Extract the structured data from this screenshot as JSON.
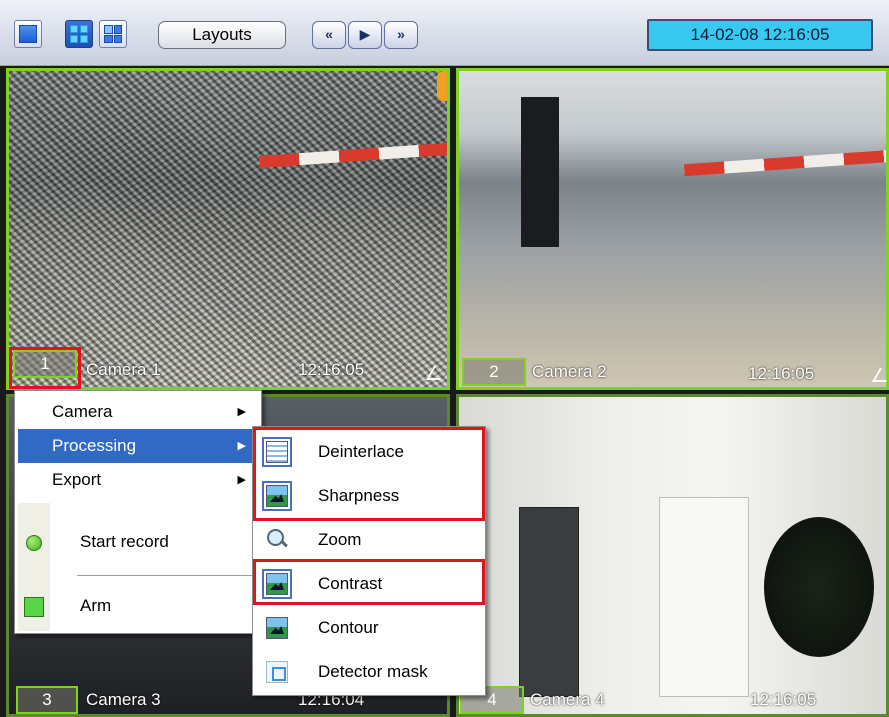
{
  "toolbar": {
    "layouts_label": "Layouts",
    "nav_prev": "«",
    "nav_play": "▶",
    "nav_next": "»",
    "datetime": "14-02-08   12:16:05"
  },
  "cameras": [
    {
      "number": "1",
      "name": "Camera 1",
      "time": "12:16:05"
    },
    {
      "number": "2",
      "name": "Camera 2",
      "time": "12:16:05"
    },
    {
      "number": "3",
      "name": "Camera 3",
      "time": "12:16:04"
    },
    {
      "number": "4",
      "name": "Camera 4",
      "time": "12:16:05"
    }
  ],
  "context_menu": {
    "items": [
      "Camera",
      "Processing",
      "Export",
      "Start record",
      "Arm"
    ],
    "selected": "Processing"
  },
  "processing_menu": {
    "items": [
      "Deinterlace",
      "Sharpness",
      "Zoom",
      "Contrast",
      "Contour",
      "Detector mask"
    ]
  },
  "colors": {
    "active_frame": "#7ed321",
    "highlight_box": "#e0141e",
    "menu_selection": "#316ac5",
    "datetime_bg": "#38c8f0"
  }
}
